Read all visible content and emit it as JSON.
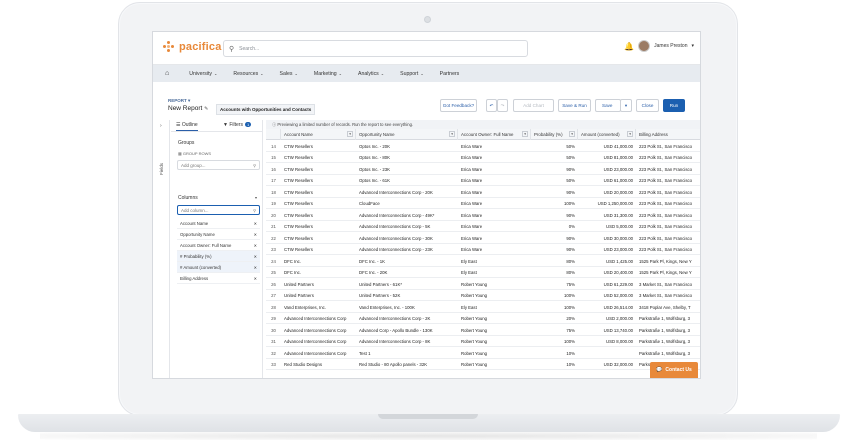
{
  "brand": {
    "name": "pacifica",
    "accent": "#e8893a",
    "primary": "#1b5fb0"
  },
  "header": {
    "search_placeholder": "Search...",
    "user_name": "James Preston",
    "bell_icon": "bell-icon"
  },
  "nav": {
    "items": [
      "University",
      "Resources",
      "Sales",
      "Marketing",
      "Analytics",
      "Support",
      "Partners"
    ]
  },
  "report": {
    "type_label": "REPORT ▾",
    "name": "New Report",
    "report_type": "Accounts with Opportunities and Contacts",
    "buttons": {
      "feedback": "Got Feedback?",
      "add_chart": "Add Chart",
      "save_run": "Save & Run",
      "save": "Save",
      "close": "Close",
      "run": "Run"
    }
  },
  "left_panel": {
    "tab_outline": "Outline",
    "tab_filters": "Filters",
    "filters_count": "1",
    "fields_tab": "Fields",
    "groups_title": "Groups",
    "group_rows_label": "GROUP ROWS",
    "add_group_placeholder": "Add group...",
    "columns_title": "Columns",
    "add_column_placeholder": "Add column...",
    "columns": [
      "Account Name",
      "Opportunity Name",
      "Account Owner: Full Name",
      "# Probability (%)",
      "# Amount (converted)",
      "Billing Address"
    ]
  },
  "table": {
    "banner": "Previewing a limited number of records. Run the report to see everything.",
    "headers": [
      "Account Name",
      "Opportunity Name",
      "Account Owner: Full Name",
      "Probability (%)",
      "Amount (converted)",
      "Billing Address"
    ],
    "rows": [
      [
        "14",
        "CTW Resellers",
        "Optos Inc. - 20K",
        "Erica Ware",
        "50%",
        "USD 41,000.00",
        "223 Polk St., San Francisco"
      ],
      [
        "15",
        "CTW Resellers",
        "Optos Inc. - 80K",
        "Erica Ware",
        "50%",
        "USD 81,000.00",
        "223 Polk St., San Francisco"
      ],
      [
        "16",
        "CTW Resellers",
        "Optos Inc. - 23K",
        "Erica Ware",
        "90%",
        "USD 23,000.00",
        "223 Polk St., San Francisco"
      ],
      [
        "17",
        "CTW Resellers",
        "Optos Inc. - 61K",
        "Erica Ware",
        "50%",
        "USD 61,000.00",
        "223 Polk St., San Francisco"
      ],
      [
        "18",
        "CTW Resellers",
        "Advanced Interconnections Corp - 20K",
        "Erica Ware",
        "90%",
        "USD 20,000.00",
        "223 Polk St., San Francisco"
      ],
      [
        "19",
        "CTW Resellers",
        "CloudFace",
        "Erica Ware",
        "100%",
        "USD 1,250,000.00",
        "223 Polk St., San Francisco"
      ],
      [
        "20",
        "CTW Resellers",
        "Advanced Interconnections Corp - 49K*",
        "Erica Ware",
        "90%",
        "USD 31,300.00",
        "223 Polk St., San Francisco"
      ],
      [
        "21",
        "CTW Resellers",
        "Advanced Interconnections Corp - 5K",
        "Erica Ware",
        "0%",
        "USD 5,000.00",
        "223 Polk St., San Francisco"
      ],
      [
        "22",
        "CTW Resellers",
        "Advanced Interconnections Corp - 30K",
        "Erica Ware",
        "90%",
        "USD 30,000.00",
        "223 Polk St., San Francisco"
      ],
      [
        "23",
        "CTW Resellers",
        "Advanced Interconnections Corp - 23K",
        "Erica Ware",
        "90%",
        "USD 23,000.00",
        "223 Polk St., San Francisco"
      ],
      [
        "24",
        "DFC Inc.",
        "DFC Inc. - 1K",
        "Ely East",
        "80%",
        "USD 1,425.00",
        "1525 Park Pl, Kings, New Y"
      ],
      [
        "25",
        "DFC Inc.",
        "DFC Inc. - 20K",
        "Ely East",
        "80%",
        "USD 20,400.00",
        "1525 Park Pl, Kings, New Y"
      ],
      [
        "26",
        "United Partners",
        "United Partners - 61K*",
        "Robert Young",
        "75%",
        "USD 61,229.00",
        "3 Market St., San Francisco"
      ],
      [
        "27",
        "United Partners",
        "United Partners - 52K",
        "Robert Young",
        "100%",
        "USD 52,000.00",
        "3 Market St., San Francisco"
      ],
      [
        "28",
        "Vand Enterprises, Inc.",
        "Vand Enterprises, Inc. - 100K",
        "Ely East",
        "100%",
        "USD 26,514.00",
        "3418 Poplar Ave, Shelby, T"
      ],
      [
        "29",
        "Advanced Interconnections Corp",
        "Advanced Interconnections Corp - 2K",
        "Robert Young",
        "20%",
        "USD 2,000.00",
        "Parkstraße 1, Wolfsburg, 3"
      ],
      [
        "30",
        "Advanced Interconnections Corp",
        "Advanced Corp - Apollo Bundle - 130K",
        "Robert Young",
        "75%",
        "USD 13,740.00",
        "Parkstraße 1, Wolfsburg, 3"
      ],
      [
        "31",
        "Advanced Interconnections Corp",
        "Advanced Interconnections Corp - 8K",
        "Robert Young",
        "100%",
        "USD 8,000.00",
        "Parkstraße 1, Wolfsburg, 3"
      ],
      [
        "32",
        "Advanced Interconnections Corp",
        "Test 1",
        "Robert Young",
        "10%",
        "",
        "Parkstraße 1, Wolfsburg, 3"
      ],
      [
        "33",
        "Red Studio Designs",
        "Red Studio - 80 Apollo panels - 32K",
        "Robert Young",
        "10%",
        "USD 32,000.00",
        "Parkstraße 1, Wolfsburg, 3"
      ]
    ]
  },
  "contact_button": "Contact Us"
}
